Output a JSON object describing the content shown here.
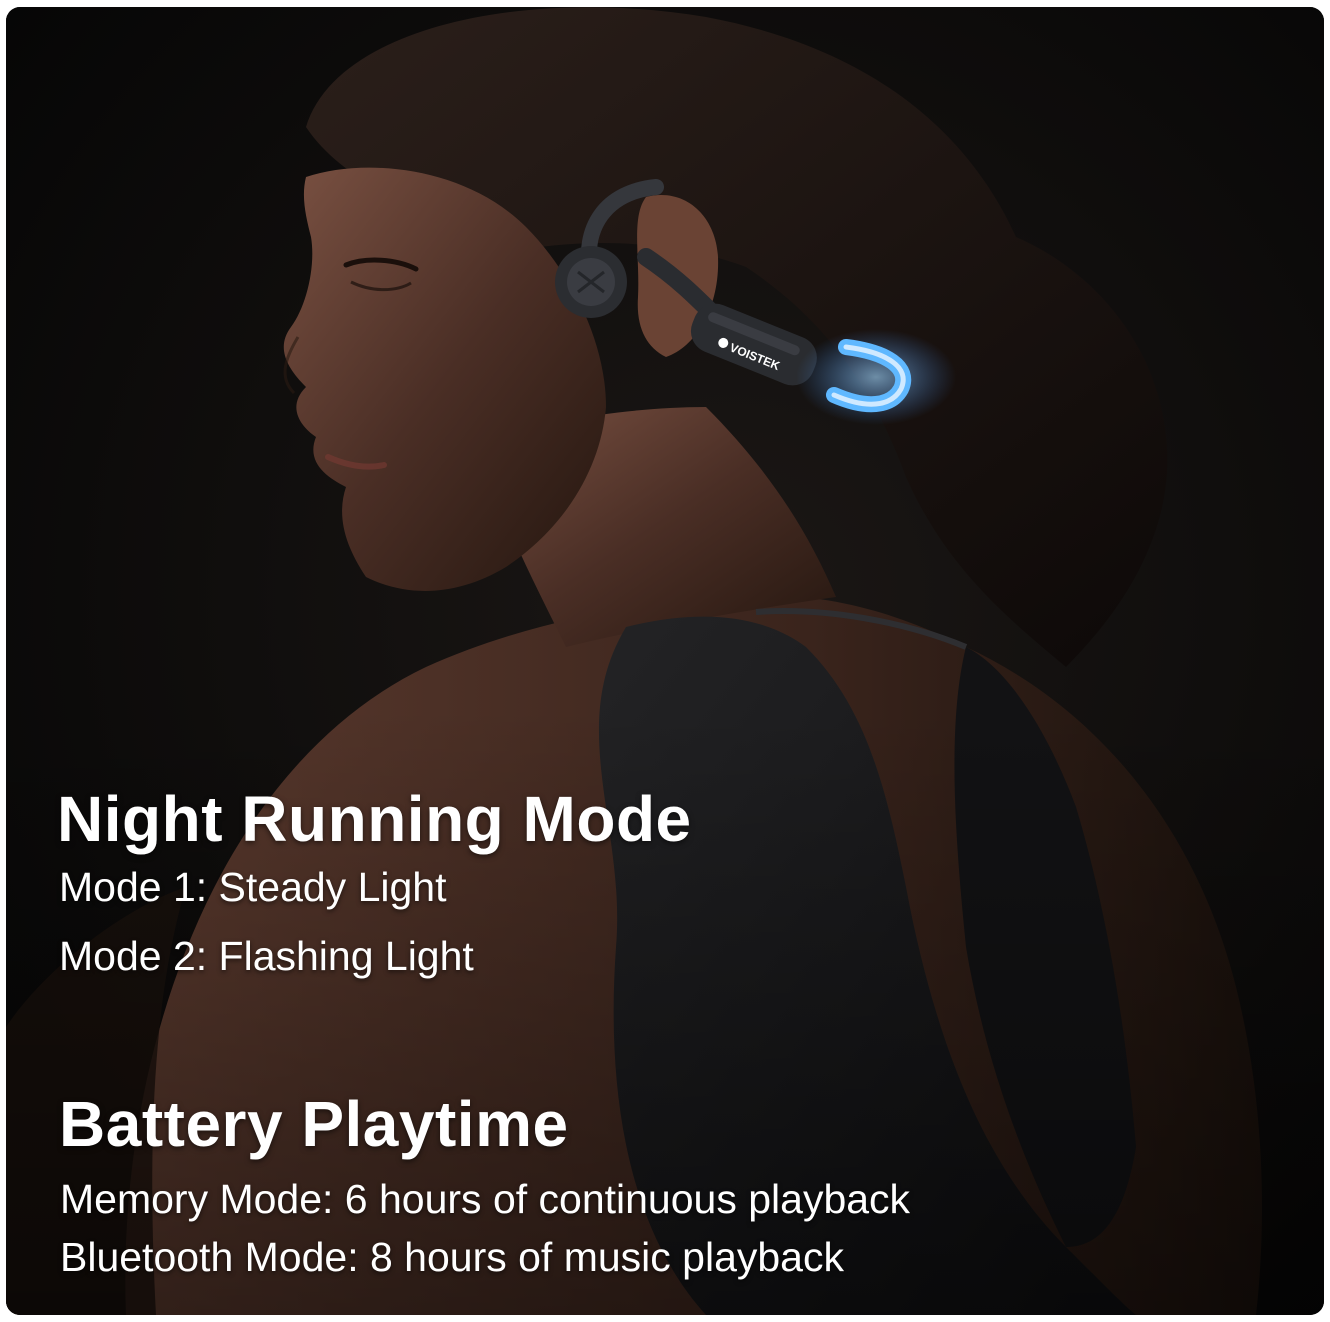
{
  "night_running": {
    "title": "Night Running Mode",
    "mode_1": "Mode 1: Steady Light",
    "mode_2": "Mode 2: Flashing Light"
  },
  "battery": {
    "title": "Battery Playtime",
    "memory_mode": "Memory Mode: 6 hours of continuous playback",
    "bluetooth_mode": "Bluetooth Mode: 8 hours of music playback"
  },
  "product": {
    "brand_logo_text": "VOISTEK",
    "led_color": "#5fb8ff",
    "headset_color": "#2a2c30"
  },
  "colors": {
    "background": "#0b0b0b",
    "text": "#ffffff"
  }
}
